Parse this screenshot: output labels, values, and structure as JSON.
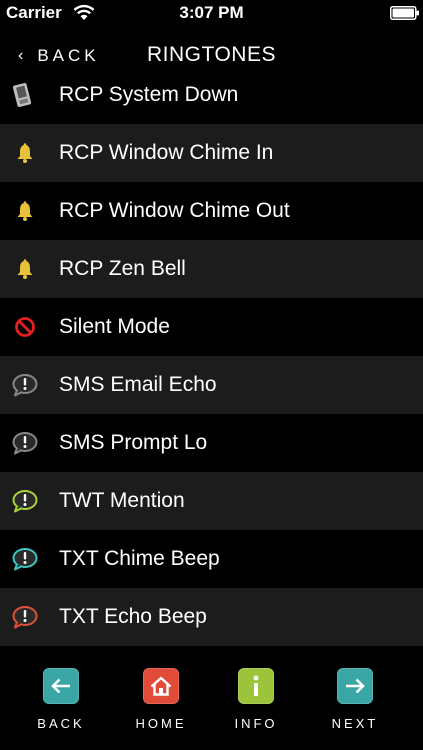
{
  "status_bar": {
    "carrier": "Carrier",
    "time": "3:07 PM"
  },
  "nav": {
    "back_label": "BACK",
    "title": "RINGTONES"
  },
  "items": [
    {
      "label": "RCP System Down",
      "icon": "phone-icon"
    },
    {
      "label": "RCP Window Chime In",
      "icon": "bell-icon"
    },
    {
      "label": "RCP Window Chime Out",
      "icon": "bell-icon"
    },
    {
      "label": "RCP Zen Bell",
      "icon": "bell-icon"
    },
    {
      "label": "Silent Mode",
      "icon": "no-sign-icon"
    },
    {
      "label": "SMS Email Echo",
      "icon": "speech-bubble-alert-icon",
      "color": "#888888"
    },
    {
      "label": "SMS Prompt Lo",
      "icon": "speech-bubble-alert-icon",
      "color": "#888888"
    },
    {
      "label": "TWT Mention",
      "icon": "speech-bubble-alert-icon",
      "color": "#a8d23a"
    },
    {
      "label": "TXT Chime Beep",
      "icon": "speech-bubble-alert-icon",
      "color": "#3ec5c5"
    },
    {
      "label": "TXT Echo Beep",
      "icon": "speech-bubble-alert-icon",
      "color": "#e0503a"
    }
  ],
  "toolbar": {
    "back": {
      "label": "BACK",
      "icon": "arrow-left-icon",
      "color": "#3aa6a6"
    },
    "home": {
      "label": "HOME",
      "icon": "home-icon",
      "color": "#e04b3a"
    },
    "info": {
      "label": "INFO",
      "icon": "info-icon",
      "color": "#9cc43a"
    },
    "next": {
      "label": "NEXT",
      "icon": "arrow-right-icon",
      "color": "#3aa6a6"
    }
  },
  "colors": {
    "row_dark": "#000000",
    "row_light": "#1c1c1c",
    "bell": "#e8c23a",
    "no_sign": "#e02020"
  }
}
